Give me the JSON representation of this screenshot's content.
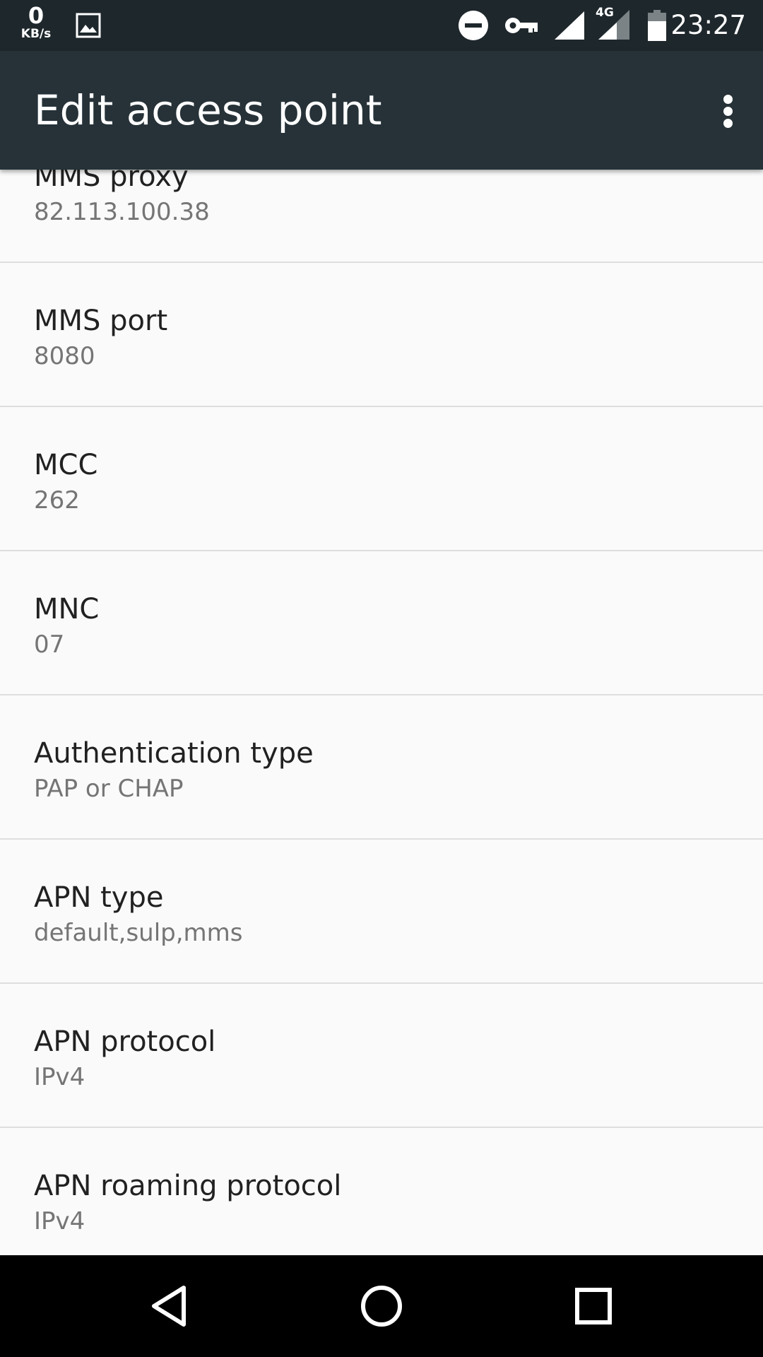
{
  "status_bar": {
    "speed_value": "0",
    "speed_unit": "KB/s",
    "network": "4G",
    "time": "23:27",
    "icons": [
      "image-icon",
      "do-not-disturb-icon",
      "vpn-key-icon",
      "signal-icon",
      "signal-4g-icon",
      "battery-icon"
    ]
  },
  "toolbar": {
    "title": "Edit access point",
    "overflow_icon": "more-vert-icon"
  },
  "items": [
    {
      "title": "MMS proxy",
      "value": "82.113.100.38"
    },
    {
      "title": "MMS port",
      "value": "8080"
    },
    {
      "title": "MCC",
      "value": "262"
    },
    {
      "title": "MNC",
      "value": "07"
    },
    {
      "title": "Authentication type",
      "value": "PAP or CHAP"
    },
    {
      "title": "APN type",
      "value": "default,sulp,mms"
    },
    {
      "title": "APN protocol",
      "value": "IPv4"
    },
    {
      "title": "APN roaming protocol",
      "value": "IPv4"
    }
  ],
  "nav_bar": {
    "icons": [
      "back-icon",
      "home-icon",
      "recents-icon"
    ]
  },
  "colors": {
    "status_bar": "#1e272c",
    "toolbar": "#263238",
    "background": "#fafafa",
    "divider": "#dedede",
    "title_text": "#212121",
    "summary_text": "#757575"
  }
}
